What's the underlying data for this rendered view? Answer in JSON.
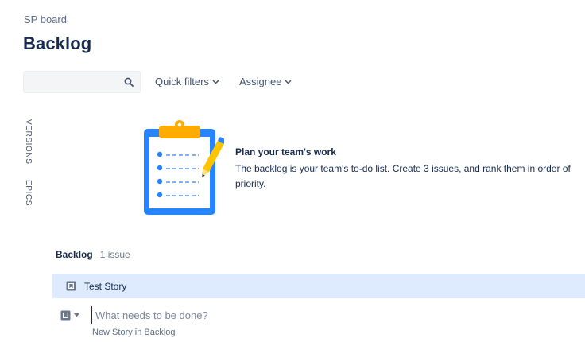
{
  "header": {
    "breadcrumb": "SP board",
    "title": "Backlog"
  },
  "toolbar": {
    "search_value": "",
    "search_icon": "search-icon",
    "quick_filters_label": "Quick filters",
    "assignee_label": "Assignee"
  },
  "side_panel": {
    "versions_label": "VERSIONS",
    "epics_label": "EPICS"
  },
  "empty_state": {
    "illustration": "clipboard-pencil-illustration",
    "title": "Plan your team's work",
    "description": "The backlog is your team's to-do list. Create 3 issues, and rank them in order of priority."
  },
  "backlog": {
    "title": "Backlog",
    "count": "1 issue",
    "issues": [
      {
        "type_icon": "story-icon",
        "name": "Test Story"
      }
    ],
    "create": {
      "placeholder": "What needs to be done?",
      "hint": "New Story in Backlog"
    }
  },
  "colors": {
    "selected_row": "#deebff",
    "clipboard_blue": "#2684ff",
    "clip_yellow": "#ffc400",
    "text_primary": "#172b4d"
  }
}
